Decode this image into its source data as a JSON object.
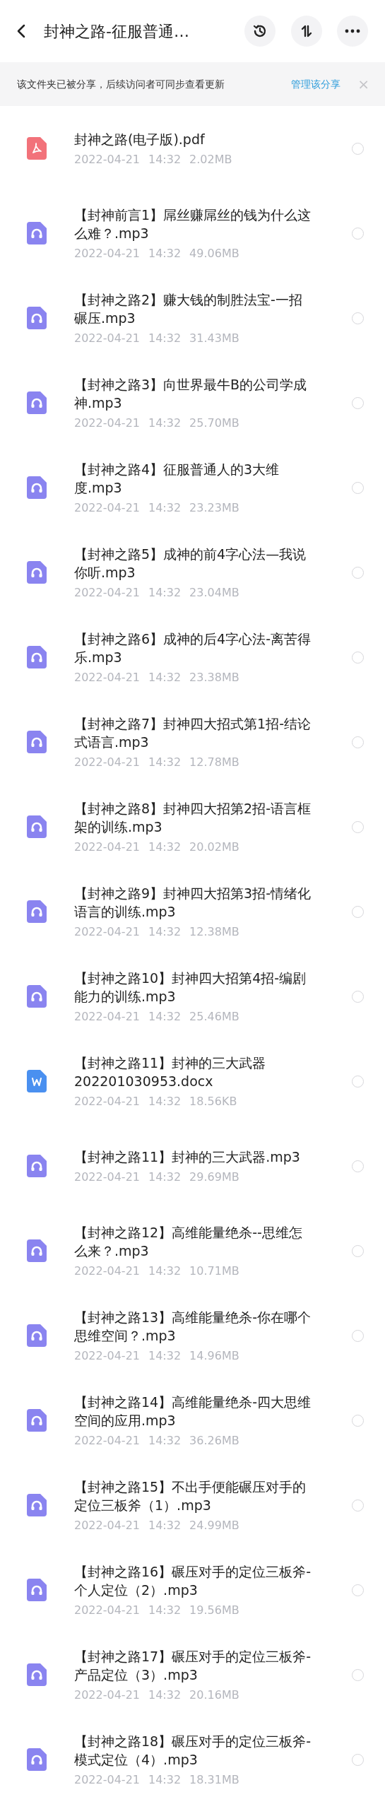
{
  "header": {
    "title": "封神之路-征服普通…"
  },
  "banner": {
    "text": "该文件夹已被分享，后续访问者可同步查看更新",
    "link": "管理该分享",
    "close": "×"
  },
  "files": [
    {
      "kind": "pdf",
      "name": "封神之路(电子版).pdf",
      "date": "2022-04-21",
      "time": "14:32",
      "size": "2.02MB",
      "selected": false
    },
    {
      "kind": "audio",
      "name": "【封神前言1】屌丝赚屌丝的钱为什么这么难？.mp3",
      "date": "2022-04-21",
      "time": "14:32",
      "size": "49.06MB",
      "selected": false
    },
    {
      "kind": "audio",
      "name": "【封神之路2】赚大钱的制胜法宝-一招碾压.mp3",
      "date": "2022-04-21",
      "time": "14:32",
      "size": "31.43MB",
      "selected": false
    },
    {
      "kind": "audio",
      "name": "【封神之路3】向世界最牛B的公司学成神.mp3",
      "date": "2022-04-21",
      "time": "14:32",
      "size": "25.70MB",
      "selected": false
    },
    {
      "kind": "audio",
      "name": "【封神之路4】征服普通人的3大维度.mp3",
      "date": "2022-04-21",
      "time": "14:32",
      "size": "23.23MB",
      "selected": false
    },
    {
      "kind": "audio",
      "name": "【封神之路5】成神的前4字心法—我说你听.mp3",
      "date": "2022-04-21",
      "time": "14:32",
      "size": "23.04MB",
      "selected": false
    },
    {
      "kind": "audio",
      "name": "【封神之路6】成神的后4字心法-离苦得乐.mp3",
      "date": "2022-04-21",
      "time": "14:32",
      "size": "23.38MB",
      "selected": false
    },
    {
      "kind": "audio",
      "name": "【封神之路7】封神四大招式第1招-结论式语言.mp3",
      "date": "2022-04-21",
      "time": "14:32",
      "size": "12.78MB",
      "selected": false
    },
    {
      "kind": "audio",
      "name": "【封神之路8】封神四大招第2招-语言框架的训练.mp3",
      "date": "2022-04-21",
      "time": "14:32",
      "size": "20.02MB",
      "selected": false
    },
    {
      "kind": "audio",
      "name": "【封神之路9】封神四大招第3招-情绪化语言的训练.mp3",
      "date": "2022-04-21",
      "time": "14:32",
      "size": "12.38MB",
      "selected": false
    },
    {
      "kind": "audio",
      "name": "【封神之路10】封神四大招第4招-编剧能力的训练.mp3",
      "date": "2022-04-21",
      "time": "14:32",
      "size": "25.46MB",
      "selected": false
    },
    {
      "kind": "word",
      "name": "【封神之路11】封神的三大武器202201030953.docx",
      "date": "2022-04-21",
      "time": "14:32",
      "size": "18.56KB",
      "selected": false
    },
    {
      "kind": "audio",
      "name": "【封神之路11】封神的三大武器.mp3",
      "date": "2022-04-21",
      "time": "14:32",
      "size": "29.69MB",
      "selected": false
    },
    {
      "kind": "audio",
      "name": "【封神之路12】高维能量绝杀--思维怎么来？.mp3",
      "date": "2022-04-21",
      "time": "14:32",
      "size": "10.71MB",
      "selected": false
    },
    {
      "kind": "audio",
      "name": "【封神之路13】高维能量绝杀-你在哪个思维空间？.mp3",
      "date": "2022-04-21",
      "time": "14:32",
      "size": "14.96MB",
      "selected": false
    },
    {
      "kind": "audio",
      "name": "【封神之路14】高维能量绝杀-四大思维空间的应用.mp3",
      "date": "2022-04-21",
      "time": "14:32",
      "size": "36.26MB",
      "selected": false
    },
    {
      "kind": "audio",
      "name": "【封神之路15】不出手便能碾压对手的定位三板斧（1）.mp3",
      "date": "2022-04-21",
      "time": "14:32",
      "size": "24.99MB",
      "selected": false
    },
    {
      "kind": "audio",
      "name": "【封神之路16】碾压对手的定位三板斧-个人定位（2）.mp3",
      "date": "2022-04-21",
      "time": "14:32",
      "size": "19.56MB",
      "selected": false
    },
    {
      "kind": "audio",
      "name": "【封神之路17】碾压对手的定位三板斧-产品定位（3）.mp3",
      "date": "2022-04-21",
      "time": "14:32",
      "size": "20.16MB",
      "selected": false
    },
    {
      "kind": "audio",
      "name": "【封神之路18】碾压对手的定位三板斧-模式定位（4）.mp3",
      "date": "2022-04-21",
      "time": "14:32",
      "size": "18.31MB",
      "selected": false
    }
  ]
}
